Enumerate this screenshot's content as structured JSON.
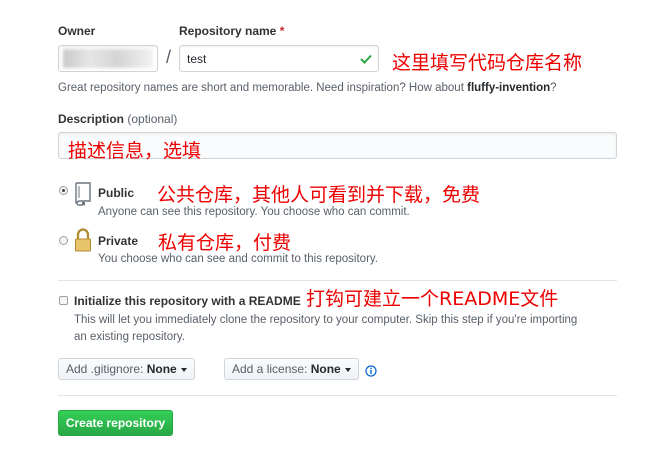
{
  "owner": {
    "label": "Owner",
    "value": ""
  },
  "separator": "/",
  "repo_name": {
    "label": "Repository name",
    "required_mark": "*",
    "value": "test"
  },
  "repo_annotation": "这里填写代码仓库名称",
  "name_hint": {
    "text": "Great repository names are short and memorable. Need inspiration? How about ",
    "suggestion": "fluffy-invention",
    "suffix": "?"
  },
  "description": {
    "label": "Description",
    "optional": "(optional)",
    "value": ""
  },
  "description_annotation": "描述信息，选填",
  "visibility": {
    "public": {
      "label": "Public",
      "desc": "Anyone can see this repository. You choose who can commit.",
      "selected": true
    },
    "private": {
      "label": "Private",
      "desc": "You choose who can see and commit to this repository.",
      "selected": false
    }
  },
  "public_annotation": "公共仓库，其他人可看到并下载，免费",
  "private_annotation": "私有仓库，付费",
  "readme": {
    "label": "Initialize this repository with a README",
    "desc_line1": "This will let you immediately clone the repository to your computer. Skip this step if you're importing",
    "desc_line2": "an existing repository.",
    "checked": false
  },
  "readme_annotation": "打钩可建立一个README文件",
  "gitignore": {
    "prefix": "Add .gitignore:",
    "value": "None"
  },
  "license": {
    "prefix": "Add a license:",
    "value": "None"
  },
  "create_button": "Create repository",
  "colors": {
    "annotation": "#ee0000",
    "create_button": "#2ea44f",
    "check": "#28a745",
    "info_icon": "#0366d6"
  }
}
